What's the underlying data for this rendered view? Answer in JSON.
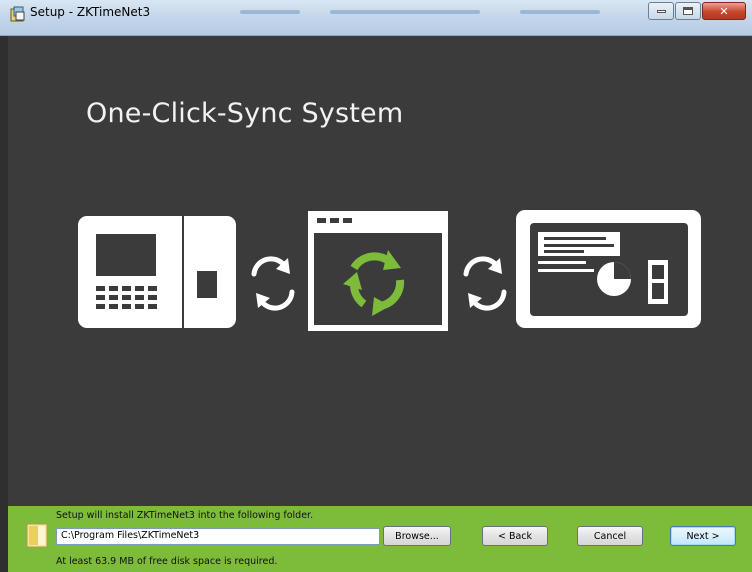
{
  "window": {
    "title": "Setup - ZKTimeNet3",
    "controls": [
      "minimize",
      "maximize",
      "close"
    ]
  },
  "hero": {
    "headline": "One-Click-Sync System",
    "icons": [
      "time-attendance-device-icon",
      "sync-arrows-icon",
      "software-window-sync-icon",
      "sync-arrows-icon",
      "report-dashboard-icon"
    ]
  },
  "install": {
    "message": "Setup will install ZKTimeNet3 into the following folder.",
    "path_value": "C:\\Program Files\\ZKTimeNet3",
    "disk_space": "At least 63.9 MB of free disk space is required."
  },
  "buttons": {
    "browse": "Browse...",
    "back": "< Back",
    "cancel": "Cancel",
    "next": "Next >"
  },
  "colors": {
    "background": "#3b3b3b",
    "accent_green": "#7dbb3a",
    "icon_white": "#ffffff"
  }
}
